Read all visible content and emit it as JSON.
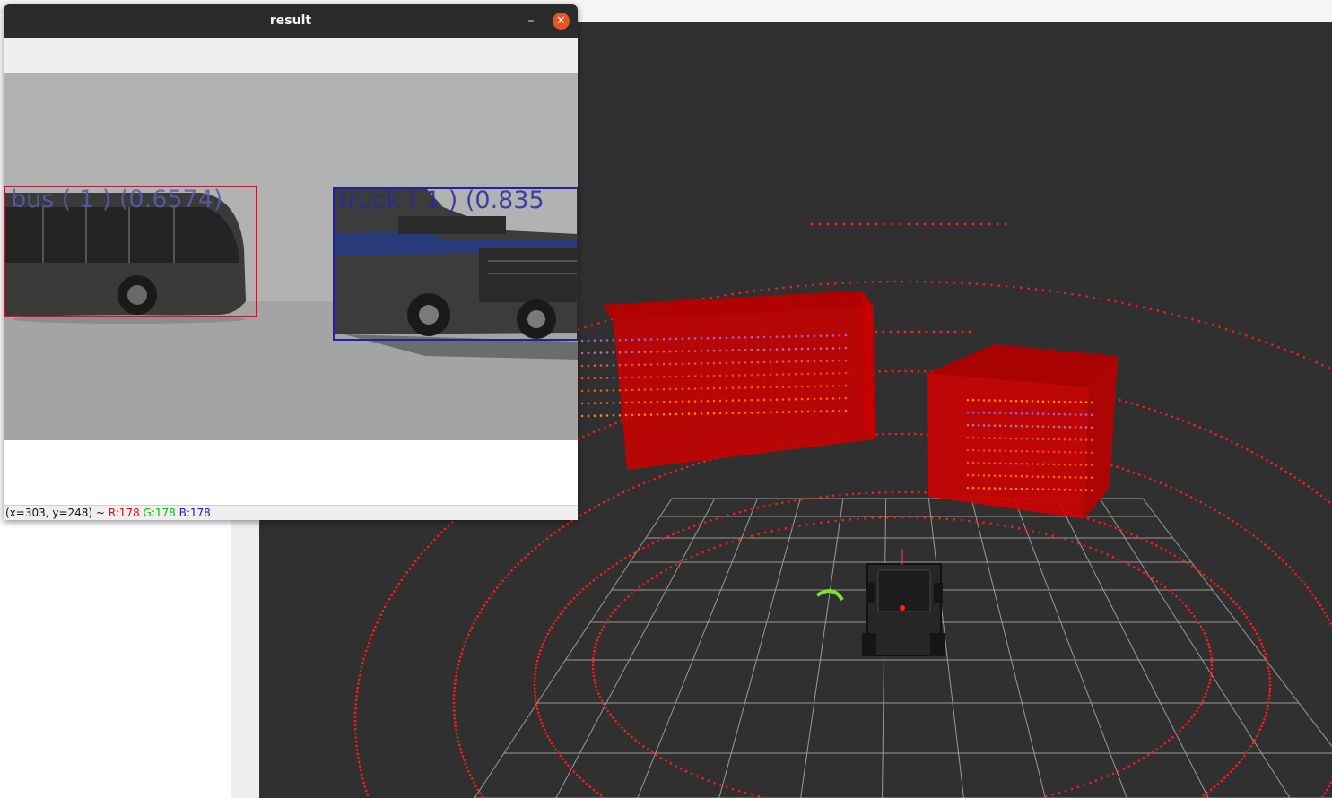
{
  "window": {
    "title": "result",
    "minimize_label": "–",
    "close_label": "✕"
  },
  "detections": [
    {
      "label": "bus ( 1 ) (0.6574)",
      "color": "#b0203a"
    },
    {
      "label": "truck ( 1 ) (0.835",
      "color": "#2020a8"
    }
  ],
  "status": {
    "coords": "(x=303, y=248) ~ ",
    "r": "R:178",
    "g": "G:178",
    "b": "B:178"
  },
  "viewport": {
    "background": "#303030",
    "grid_color": "#a0a0a0",
    "bounding_box_color": "#e00000",
    "point_color": "#ff1a1a"
  }
}
